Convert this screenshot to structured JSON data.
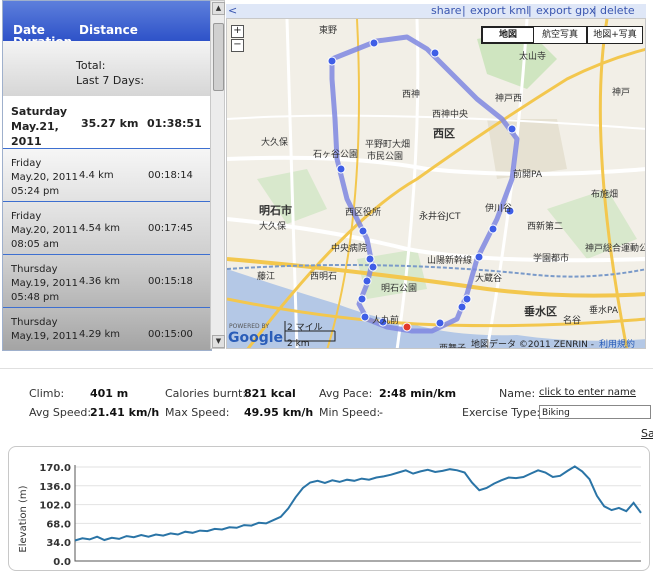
{
  "list": {
    "header_date": "Date",
    "header_duration": "Duration",
    "header_distance": "Distance",
    "total_label": "Total:",
    "last7_label": "Last 7 Days:",
    "selected": {
      "day": "Saturday",
      "date": "May.21,",
      "year": "2011",
      "distance": "35.27 km",
      "duration": "01:38:51"
    },
    "rows": [
      {
        "day": "Friday",
        "date": "May.20, 2011",
        "time": "05:24 pm",
        "distance": "4.4 km",
        "duration": "00:18:14"
      },
      {
        "day": "Friday",
        "date": "May.20, 2011",
        "time": "08:05 am",
        "distance": "4.54 km",
        "duration": "00:17:45"
      },
      {
        "day": "Thursday",
        "date": "May.19, 2011",
        "time": "05:48 pm",
        "distance": "4.36 km",
        "duration": "00:15:18"
      },
      {
        "day": "Thursday",
        "date": "May.19, 2011",
        "time": "",
        "distance": "4.29 km",
        "duration": "00:15:00"
      }
    ]
  },
  "topbar": {
    "collapse": "<",
    "share": "share",
    "export_kml": "export kml",
    "export_gpx": "export gpx",
    "delete": "delete",
    "sep": "|"
  },
  "map": {
    "zoom_in": "+",
    "zoom_out": "−",
    "types": [
      "地図",
      "航空写真",
      "地図+写真"
    ],
    "scale_mi": "2 マイル",
    "scale_km": "2 km",
    "copyright": "地図データ ©2011 ZENRIN -",
    "terms": "利用規約",
    "powered": "POWERED BY",
    "google": "Google",
    "labels": {
      "akashi": "明石市",
      "nishiku": "西区",
      "tarumi": "垂水区",
      "okubo": "大久保",
      "nishiakashi": "西明石",
      "ishigaya": "石ヶ谷公園",
      "hirano": "平野町大畑",
      "shimin": "市民公園",
      "nishikuyaku": "西区役所",
      "chuo": "中央病院",
      "akashikoen": "明石公園",
      "ikawadani": "伊川谷",
      "okuradani": "大蔵谷",
      "nishijinchuo": "西神中央",
      "nishijin": "西神",
      "kobeshin": "神戸西",
      "nagaijct": "永井谷JCT",
      "sanyoshinkansen": "山陽新幹線",
      "kobekaigan": "神戸",
      "toyo": "東野",
      "hitomaru": "人丸前",
      "fujie": "藤江",
      "nishimaiko": "西舞子",
      "nishidai": "西新第二",
      "gakuentoshi": "学園都市",
      "nunohara": "布施畑",
      "kobesogo": "神戸総合運動公園",
      "taizanji": "太山寺",
      "nanake": "名谷",
      "tarumipa": "垂水PA",
      "zenkai": "前開PA",
      "okubokita": "大久保"
    }
  },
  "stats": {
    "climb_label": "Climb:",
    "climb_value": "401 m",
    "calories_label": "Calories burnt:",
    "calories_value": "821 kcal",
    "avgpace_label": "Avg Pace:",
    "avgpace_value": "2:48 min/km",
    "name_label": "Name:",
    "name_value": "click to enter name",
    "avgspeed_label": "Avg Speed:",
    "avgspeed_value": "21.41 km/h",
    "maxspeed_label": "Max Speed:",
    "maxspeed_value": "49.95 km/h",
    "minspeed_label": "Min Speed:",
    "minspeed_value": "-",
    "type_label": "Exercise Type:",
    "type_value": "Biking",
    "extra_link": "Sa"
  },
  "chart_data": {
    "type": "line",
    "title": "",
    "xlabel": "",
    "ylabel": "Elevation (m)",
    "ylim": [
      0,
      170
    ],
    "yticks": [
      "170.0",
      "136.0",
      "102.0",
      "68.0",
      "34.0",
      "0.0"
    ],
    "grid": true,
    "color": "#2a74a6",
    "series": [
      {
        "values": [
          37,
          41,
          39,
          44,
          38,
          42,
          40,
          45,
          43,
          47,
          44,
          48,
          46,
          50,
          48,
          53,
          51,
          55,
          54,
          58,
          57,
          61,
          60,
          65,
          64,
          69,
          68,
          74,
          80,
          95,
          115,
          132,
          142,
          145,
          141,
          146,
          143,
          147,
          145,
          149,
          147,
          151,
          153,
          156,
          160,
          164,
          158,
          162,
          165,
          161,
          163,
          166,
          164,
          160,
          142,
          128,
          132,
          140,
          146,
          151,
          150,
          152,
          158,
          164,
          160,
          152,
          154,
          163,
          171,
          162,
          148,
          118,
          99,
          92,
          96,
          90,
          105,
          87
        ]
      }
    ]
  }
}
